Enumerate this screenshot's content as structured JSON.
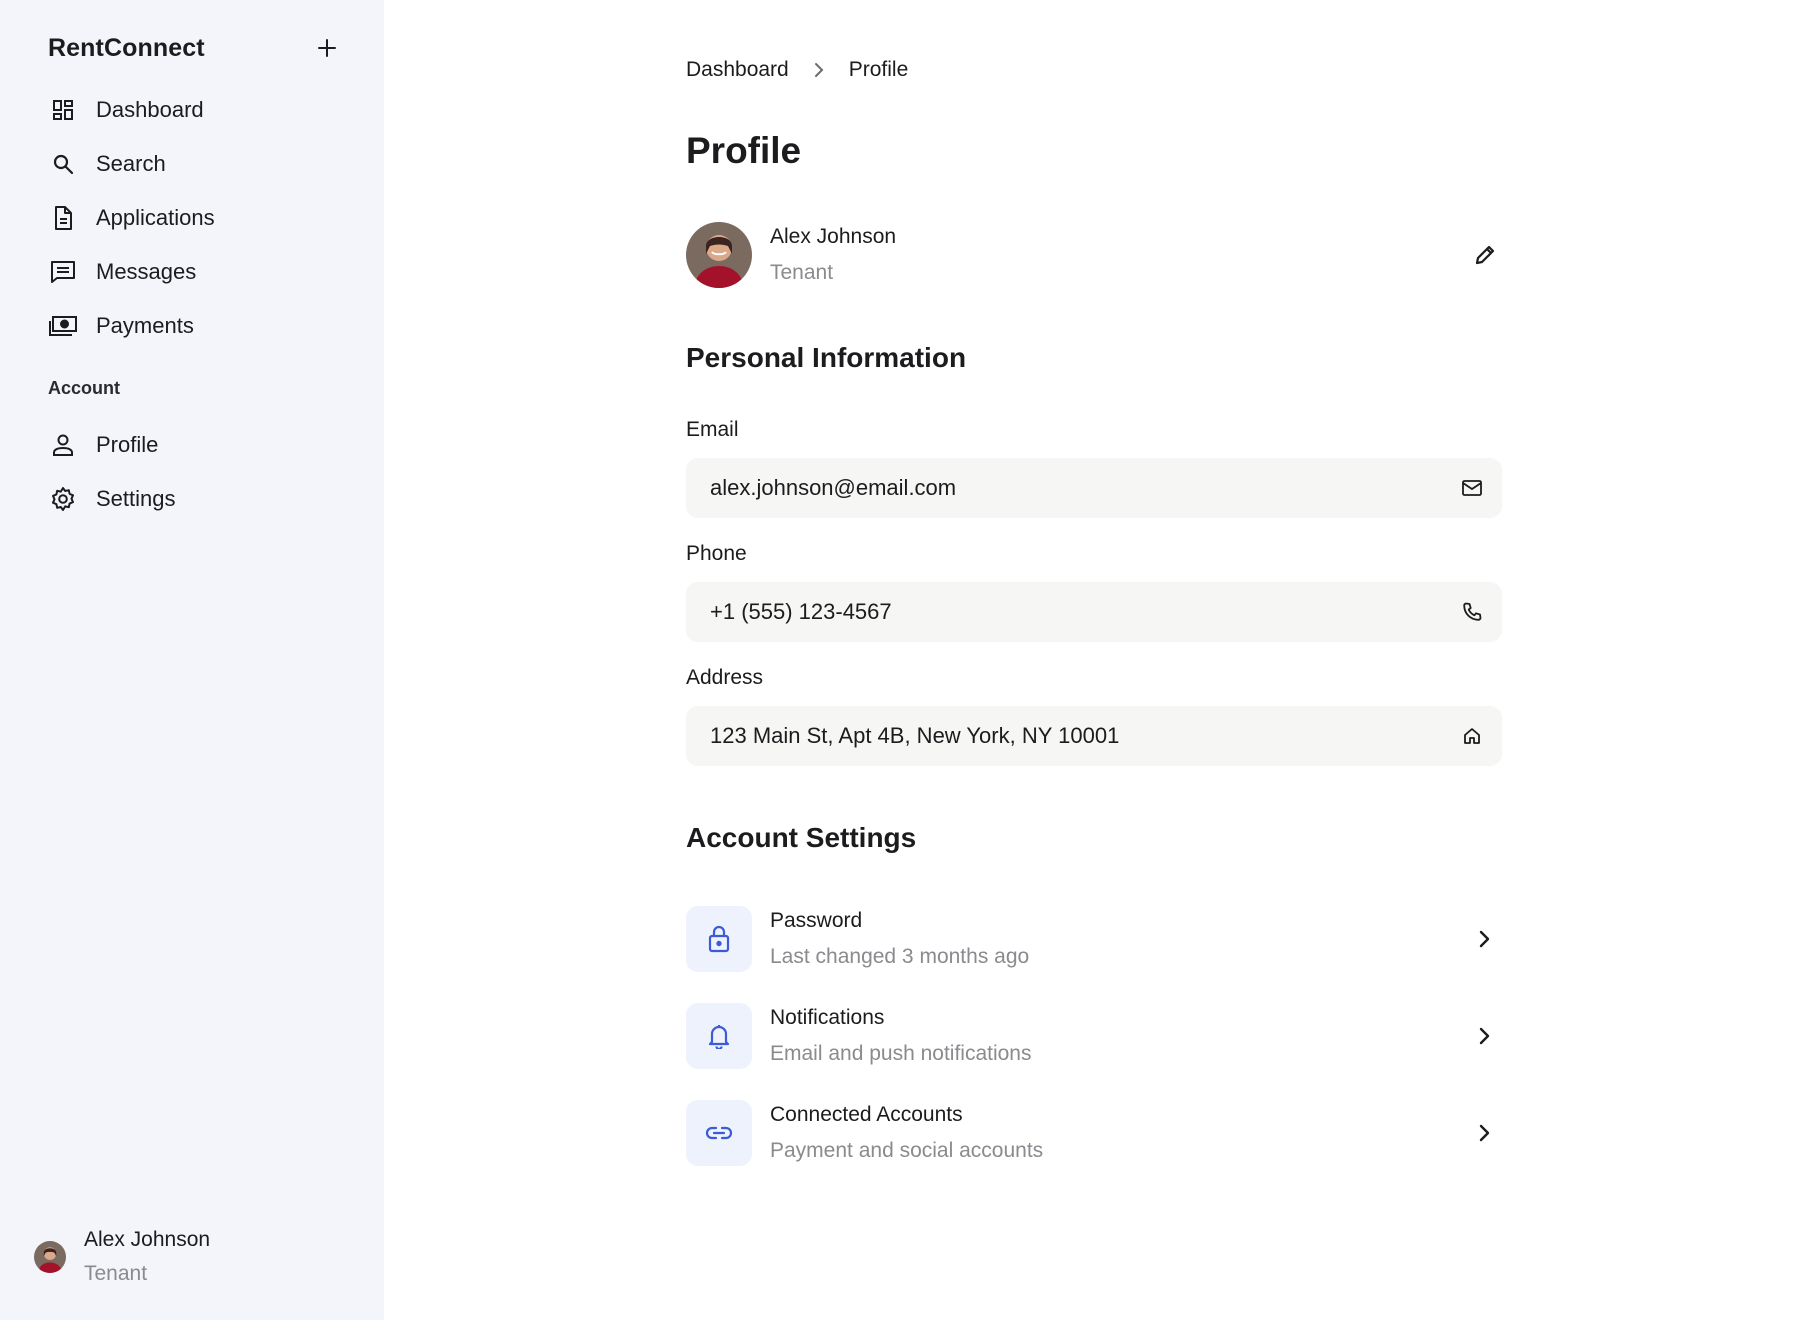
{
  "app": {
    "brand": "RentConnect"
  },
  "sidebar": {
    "items": [
      {
        "label": "Dashboard",
        "icon": "dashboard-icon"
      },
      {
        "label": "Search",
        "icon": "search-icon"
      },
      {
        "label": "Applications",
        "icon": "document-icon"
      },
      {
        "label": "Messages",
        "icon": "message-icon"
      },
      {
        "label": "Payments",
        "icon": "payments-icon"
      }
    ],
    "group_label": "Account",
    "account_items": [
      {
        "label": "Profile",
        "icon": "user-icon"
      },
      {
        "label": "Settings",
        "icon": "gear-icon"
      }
    ],
    "user": {
      "name": "Alex Johnson",
      "role": "Tenant"
    }
  },
  "breadcrumb": {
    "parent": "Dashboard",
    "current": "Profile"
  },
  "page": {
    "title": "Profile"
  },
  "profile": {
    "name": "Alex Johnson",
    "role": "Tenant"
  },
  "personal": {
    "title": "Personal Information",
    "email": {
      "label": "Email",
      "value": "alex.johnson@email.com",
      "icon": "mail-icon"
    },
    "phone": {
      "label": "Phone",
      "value": "+1 (555) 123-4567",
      "icon": "phone-icon"
    },
    "address": {
      "label": "Address",
      "value": "123 Main St, Apt 4B, New York, NY 10001",
      "icon": "home-icon"
    }
  },
  "account_settings": {
    "title": "Account Settings",
    "items": [
      {
        "title": "Password",
        "subtitle": "Last changed 3 months ago",
        "icon": "lock-icon"
      },
      {
        "title": "Notifications",
        "subtitle": "Email and push notifications",
        "icon": "bell-icon"
      },
      {
        "title": "Connected Accounts",
        "subtitle": "Payment and social accounts",
        "icon": "link-icon"
      }
    ]
  },
  "colors": {
    "sidebar_bg": "#f3f5fb",
    "accent": "#3b5bdb",
    "icon_tile_bg": "#eef2fc",
    "muted_text": "#8a8a8f",
    "field_bg": "#f6f6f5"
  }
}
